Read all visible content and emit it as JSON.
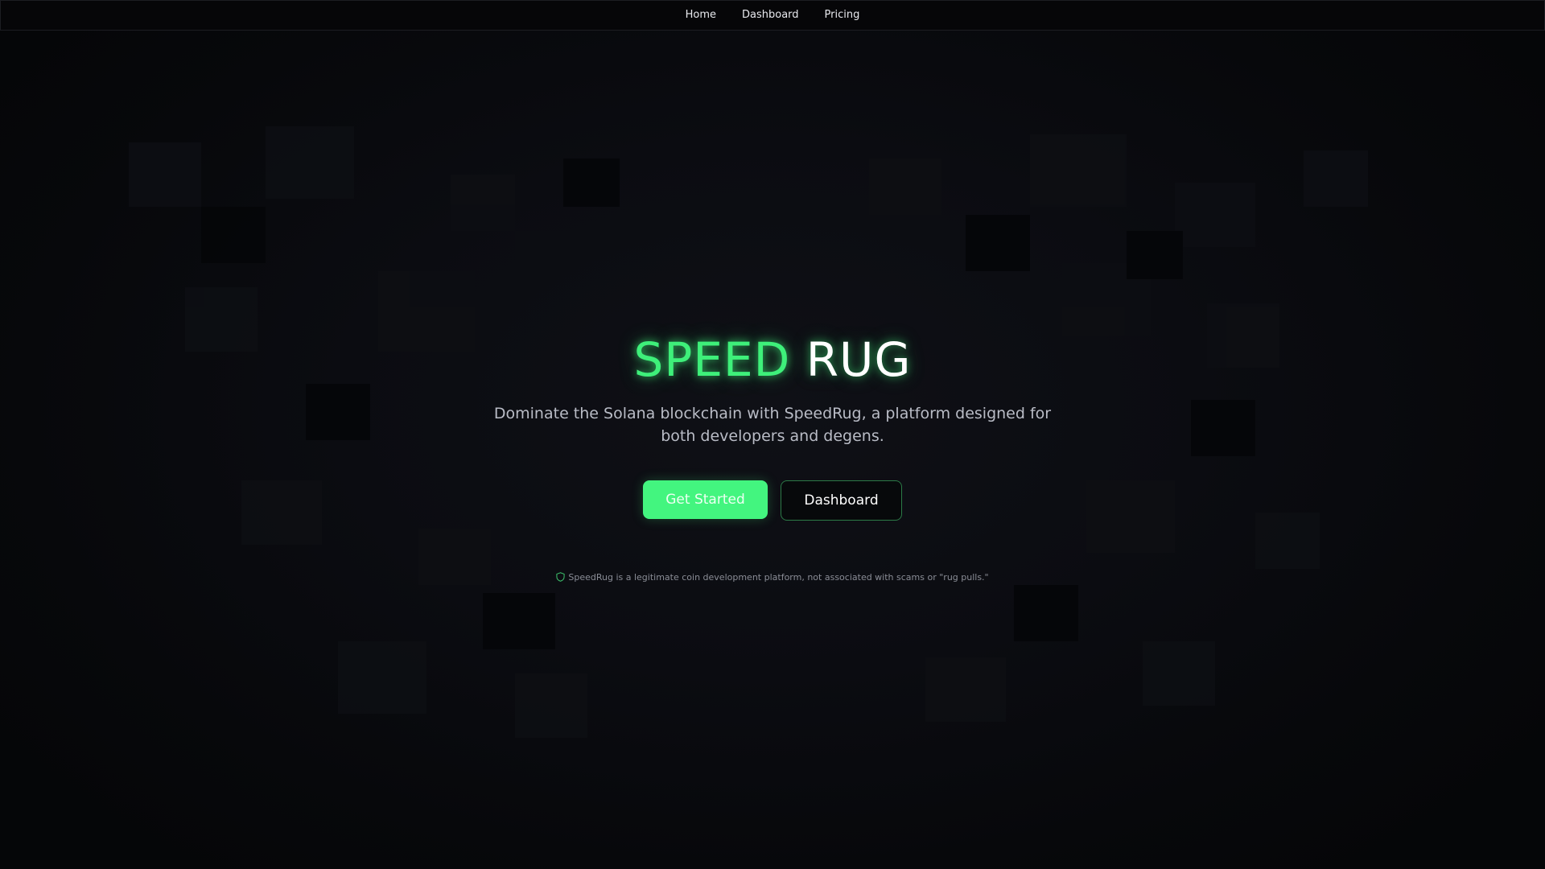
{
  "nav": {
    "items": [
      {
        "label": "Home"
      },
      {
        "label": "Dashboard"
      },
      {
        "label": "Pricing"
      }
    ]
  },
  "hero": {
    "title_accent": "SPEED",
    "title_rest": "RUG",
    "subtitle": "Dominate the Solana blockchain with SpeedRug, a platform designed for both developers and degens.",
    "primary_button": "Get Started",
    "secondary_button": "Dashboard",
    "disclaimer_icon": "shield-icon",
    "disclaimer": "SpeedRug is a legitimate coin development platform, not associated with scams or \"rug pulls.\""
  },
  "colors": {
    "accent": "#43f57f",
    "background": "#07080b",
    "secondary_border": "#2c7a47"
  }
}
